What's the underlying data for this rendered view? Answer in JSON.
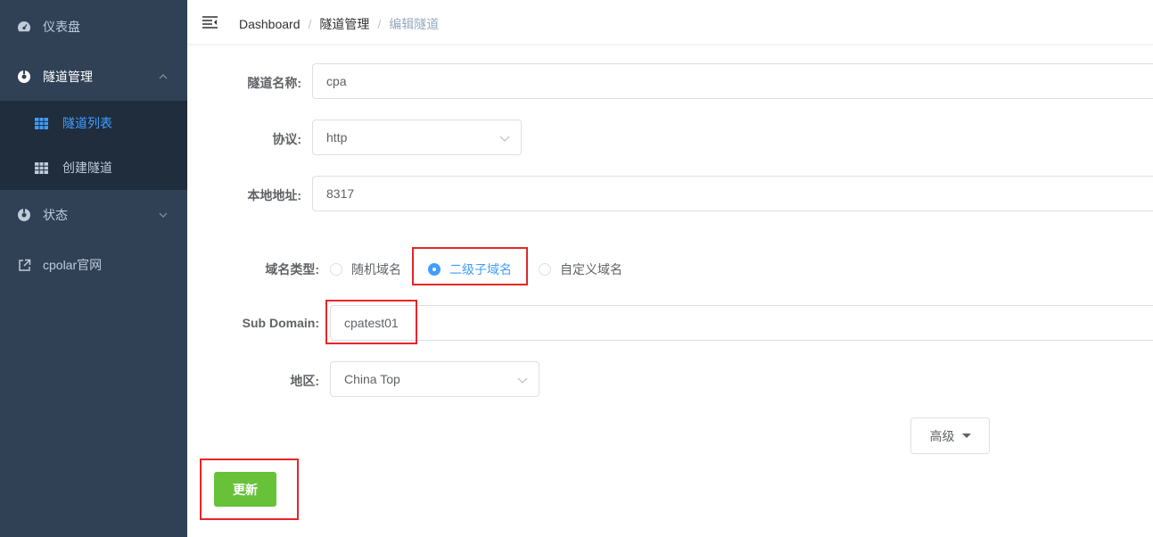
{
  "sidebar": {
    "items": [
      {
        "label": "仪表盘",
        "icon": "dashboard-icon"
      },
      {
        "label": "隧道管理",
        "icon": "tunnel-icon",
        "expanded": true
      },
      {
        "label": "状态",
        "icon": "status-icon"
      },
      {
        "label": "cpolar官网",
        "icon": "external-link-icon"
      }
    ],
    "submenu": [
      {
        "label": "隧道列表",
        "icon": "table-icon",
        "active": true
      },
      {
        "label": "创建隧道",
        "icon": "table-icon"
      }
    ]
  },
  "breadcrumb": [
    "Dashboard",
    "隧道管理",
    "编辑隧道"
  ],
  "form": {
    "tunnel_name": {
      "label": "隧道名称:",
      "value": "cpa"
    },
    "protocol": {
      "label": "协议:",
      "value": "http"
    },
    "local_address": {
      "label": "本地地址:",
      "value": "8317"
    },
    "domain_type": {
      "label": "域名类型:",
      "options": [
        "随机域名",
        "二级子域名",
        "自定义域名"
      ],
      "selected": "二级子域名"
    },
    "sub_domain": {
      "label": "Sub Domain:",
      "value": "cpatest01"
    },
    "region": {
      "label": "地区:",
      "value": "China Top"
    }
  },
  "advanced_label": "高级",
  "update_label": "更新",
  "colors": {
    "sidebar_bg": "#304156",
    "submenu_bg": "#1f2d3d",
    "active": "#409eff",
    "success": "#67c23a",
    "highlight": "#e5262a"
  }
}
